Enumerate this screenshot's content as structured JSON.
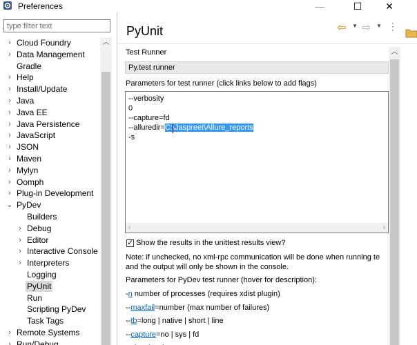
{
  "window": {
    "title": "Preferences",
    "min_glyph": "—",
    "max_glyph": "☐",
    "close_glyph": "✕"
  },
  "filter": {
    "placeholder": "type filter text"
  },
  "tree": [
    {
      "label": "Cloud Foundry",
      "arrow": "›",
      "level": 0
    },
    {
      "label": "Data Management",
      "arrow": "›",
      "level": 0
    },
    {
      "label": "Gradle",
      "arrow": "",
      "level": 0
    },
    {
      "label": "Help",
      "arrow": "›",
      "level": 0
    },
    {
      "label": "Install/Update",
      "arrow": "›",
      "level": 0
    },
    {
      "label": "Java",
      "arrow": "›",
      "level": 0
    },
    {
      "label": "Java EE",
      "arrow": "›",
      "level": 0
    },
    {
      "label": "Java Persistence",
      "arrow": "›",
      "level": 0
    },
    {
      "label": "JavaScript",
      "arrow": "›",
      "level": 0
    },
    {
      "label": "JSON",
      "arrow": "›",
      "level": 0
    },
    {
      "label": "Maven",
      "arrow": "›",
      "level": 0
    },
    {
      "label": "Mylyn",
      "arrow": "›",
      "level": 0
    },
    {
      "label": "Oomph",
      "arrow": "›",
      "level": 0
    },
    {
      "label": "Plug-in Development",
      "arrow": "›",
      "level": 0
    },
    {
      "label": "PyDev",
      "arrow": "⌄",
      "level": 0
    },
    {
      "label": "Builders",
      "arrow": "",
      "level": 1
    },
    {
      "label": "Debug",
      "arrow": "›",
      "level": 1
    },
    {
      "label": "Editor",
      "arrow": "›",
      "level": 1
    },
    {
      "label": "Interactive Console",
      "arrow": "›",
      "level": 1
    },
    {
      "label": "Interpreters",
      "arrow": "›",
      "level": 1
    },
    {
      "label": "Logging",
      "arrow": "",
      "level": 1
    },
    {
      "label": "PyUnit",
      "arrow": "",
      "level": 1,
      "selected": true
    },
    {
      "label": "Run",
      "arrow": "",
      "level": 1
    },
    {
      "label": "Scripting PyDev",
      "arrow": "",
      "level": 1
    },
    {
      "label": "Task Tags",
      "arrow": "",
      "level": 1
    },
    {
      "label": "Remote Systems",
      "arrow": "›",
      "level": 0
    },
    {
      "label": "Run/Debug",
      "arrow": "›",
      "level": 0
    }
  ],
  "page": {
    "title": "PyUnit",
    "test_runner_label": "Test Runner",
    "test_runner_value": "Py.test runner",
    "params_label": "Parameters for test runner  (click links below to add flags)",
    "params_lines": [
      "--verbosity",
      "0",
      "--capture=fd",
      "--alluredir=",
      "-s"
    ],
    "alluredir_selected": "C:\\Jaspreet\\Allure_reports",
    "show_results_checkbox": "Show the results in the unittest results view?",
    "show_results_checked": true,
    "note_line1": "Note: if unchecked, no xml-rpc communication will be done when running te",
    "note_line2": "and the output will only be shown in the console.",
    "pydev_params_label": "Parameters for PyDev test runner (hover for description):",
    "flags": [
      {
        "dashes": "-",
        "link": "n",
        "desc": " number of processes (requires xdist plugin)"
      },
      {
        "dashes": "--",
        "link": "maxfail",
        "desc": "=number (max number of failures)"
      },
      {
        "dashes": "--",
        "link": "tb",
        "desc": "=long | native | short | line"
      },
      {
        "dashes": "--",
        "link": "capture",
        "desc": "=no | sys | fd"
      },
      {
        "dashes": "--",
        "link": "showlocals",
        "desc": ""
      }
    ]
  },
  "colors": {
    "selection": "#3399ff",
    "link": "#0063c9",
    "nav_back": "#d08a00"
  }
}
